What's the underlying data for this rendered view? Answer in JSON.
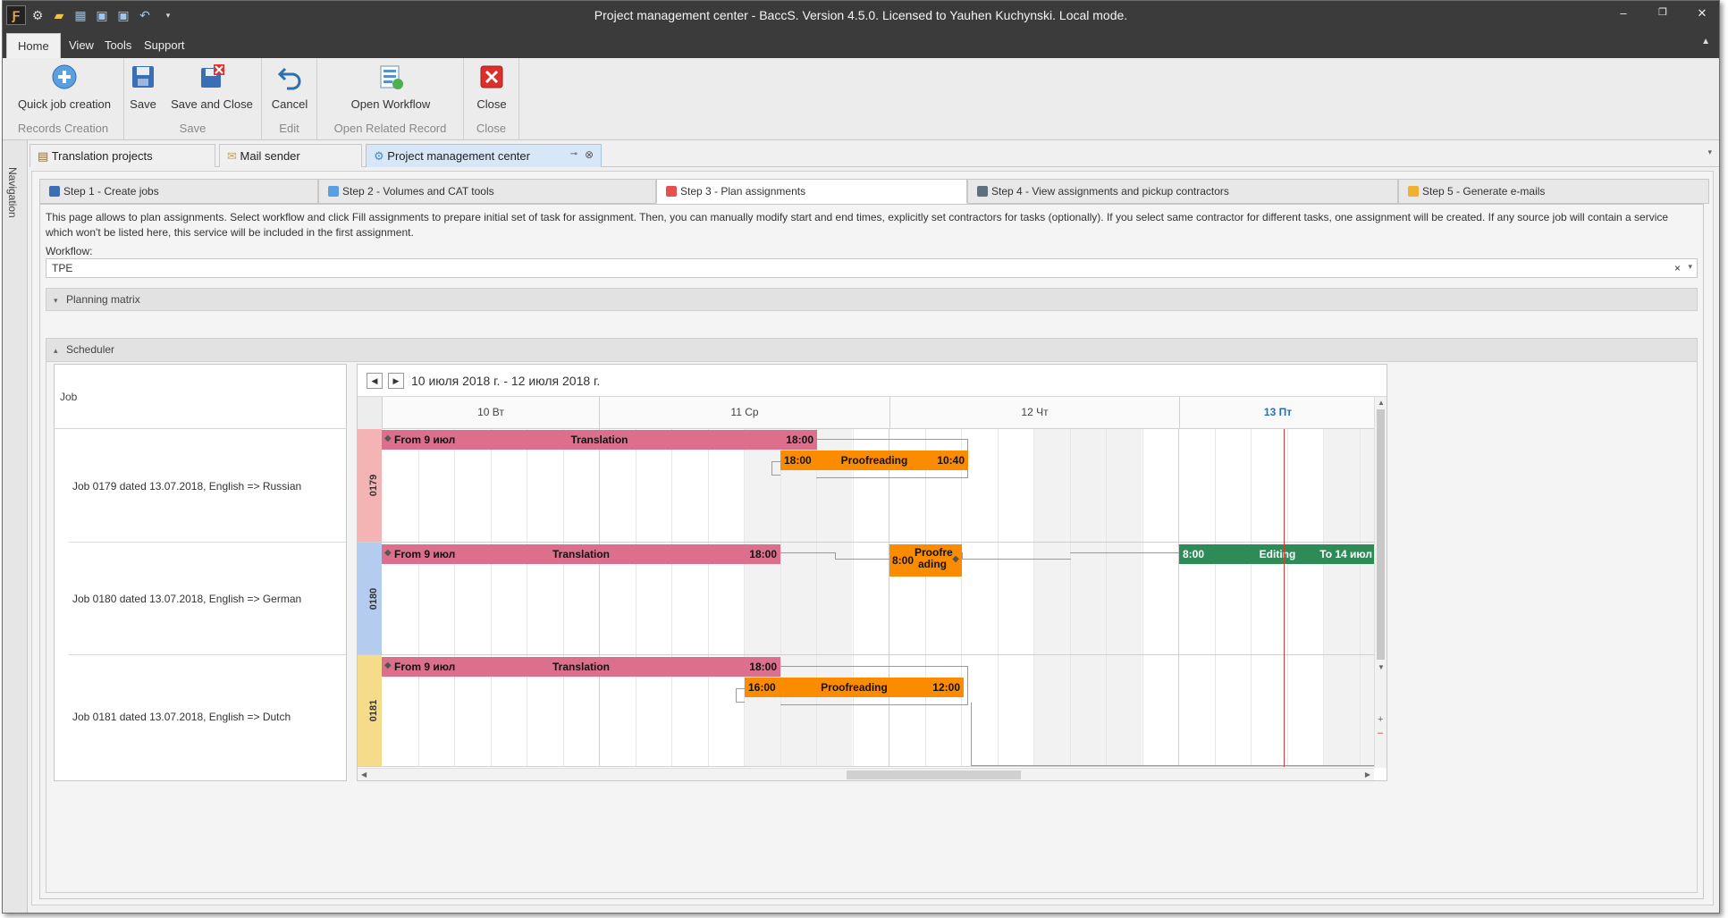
{
  "window": {
    "title": "Project management center - BaccS. Version 4.5.0. Licensed to Yauhen Kuchynski. Local mode."
  },
  "ribbon_tabs": [
    {
      "label": "Home"
    },
    {
      "label": "View"
    },
    {
      "label": "Tools"
    },
    {
      "label": "Support"
    }
  ],
  "ribbon": {
    "quick_job": "Quick job creation",
    "records_creation": "Records Creation",
    "save": "Save",
    "save_close": "Save and Close",
    "save_group": "Save",
    "cancel": "Cancel",
    "edit_group": "Edit",
    "open_workflow": "Open Workflow",
    "open_related_group": "Open Related Record",
    "close": "Close",
    "close_group": "Close"
  },
  "navigation_label": "Navigation",
  "doc_tabs": [
    {
      "label": "Translation projects"
    },
    {
      "label": "Mail sender"
    },
    {
      "label": "Project management center"
    }
  ],
  "steps": [
    {
      "label": "Step 1 - Create jobs"
    },
    {
      "label": "Step 2 - Volumes and CAT tools"
    },
    {
      "label": "Step 3 - Plan assignments"
    },
    {
      "label": "Step 4 - View assignments and pickup contractors"
    },
    {
      "label": "Step 5 - Generate e-mails"
    }
  ],
  "description": "This page allows to plan assignments. Select workflow and click Fill assignments to prepare initial set of task for assignment. Then, you can manually modify start and end times, explicitly set contractors for tasks (optionally). If you select same contractor for different tasks, one assignment will be created. If any source job will contain a service which won't be listed here, this service will be included in the first assignment.",
  "workflow": {
    "label": "Workflow:",
    "value": "TPE",
    "clear": "×"
  },
  "planning_matrix": "Planning matrix",
  "scheduler_title": "Scheduler",
  "job_header": "Job",
  "jobs": [
    {
      "label": "Job 0179 dated 13.07.2018, English => Russian",
      "code": "0179",
      "color": "#f4b4b4"
    },
    {
      "label": "Job 0180 dated 13.07.2018, English => German",
      "code": "0180",
      "color": "#b4ccf0"
    },
    {
      "label": "Job 0181 dated 13.07.2018, English => Dutch",
      "code": "0181",
      "color": "#f6dc8a"
    }
  ],
  "date_range": "10 июля 2018 г. - 12 июля 2018 г.",
  "days": [
    {
      "label": "10 Вт",
      "today": false
    },
    {
      "label": "11 Ср",
      "today": false
    },
    {
      "label": "12 Чт",
      "today": false
    },
    {
      "label": "13 Пт",
      "today": true
    }
  ],
  "bars": {
    "r0_trans": {
      "start": "From 9 июл",
      "name": "Translation",
      "end": "18:00"
    },
    "r0_proof": {
      "start": "18:00",
      "name": "Proofreading",
      "end": "10:40"
    },
    "r1_trans": {
      "start": "From 9 июл",
      "name": "Translation",
      "end": "18:00"
    },
    "r1_proof": {
      "start": "8:00",
      "name": "Proofre\nading"
    },
    "r1_edit": {
      "start": "8:00",
      "name": "Editing",
      "end": "To 14 июл"
    },
    "r2_trans": {
      "start": "From 9 июл",
      "name": "Translation",
      "end": "18:00"
    },
    "r2_proof": {
      "start": "16:00",
      "name": "Proofreading",
      "end": "12:00"
    }
  },
  "colors": {
    "translation": "#dc6f8c",
    "proofreading": "#fb8c00",
    "editing": "#2e8b57",
    "today": "#1f6fc5",
    "now_line": "#d93c3c"
  }
}
